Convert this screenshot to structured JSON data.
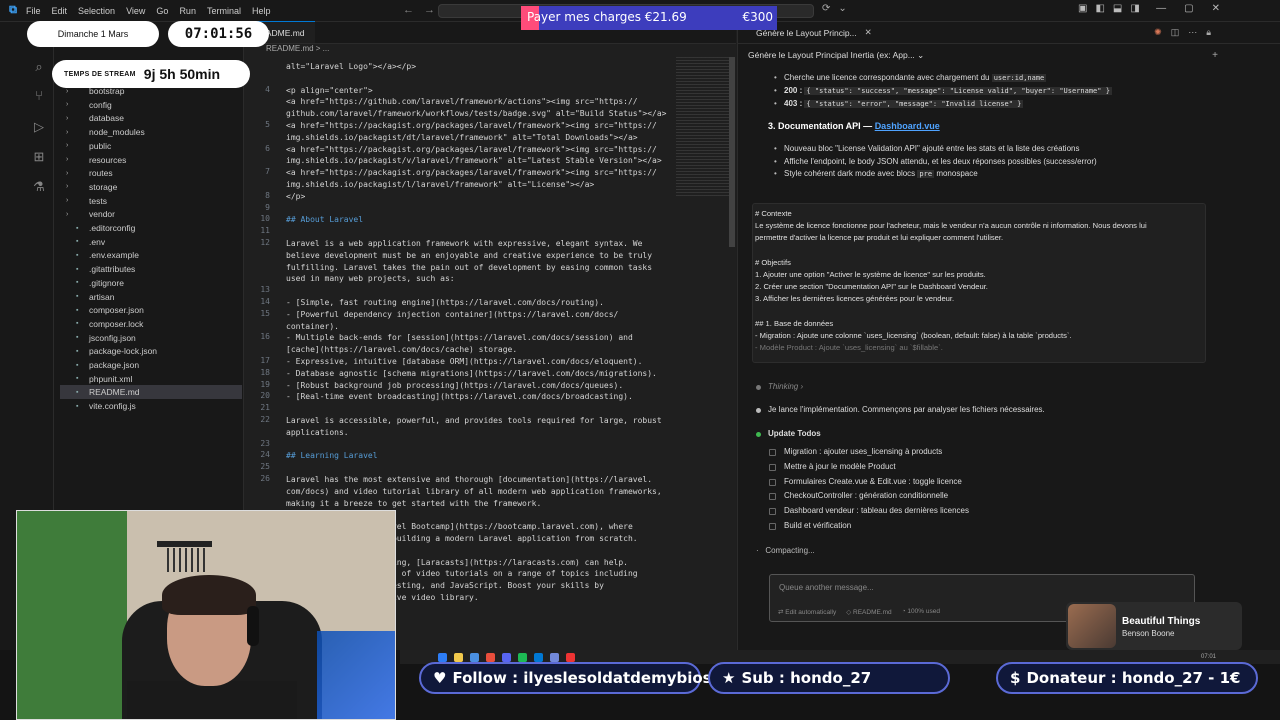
{
  "titlebar": {
    "menu": [
      "File",
      "Edit",
      "Selection",
      "View",
      "Go",
      "Run",
      "Terminal",
      "Help"
    ]
  },
  "sidebar": {
    "items": [
      {
        "label": "bootstrap",
        "kind": "folder",
        "indent": 1
      },
      {
        "label": "config",
        "kind": "folder",
        "indent": 1
      },
      {
        "label": "database",
        "kind": "folder",
        "indent": 1
      },
      {
        "label": "node_modules",
        "kind": "folder",
        "indent": 1
      },
      {
        "label": "public",
        "kind": "folder",
        "indent": 1
      },
      {
        "label": "resources",
        "kind": "folder",
        "indent": 1
      },
      {
        "label": "routes",
        "kind": "folder",
        "indent": 1
      },
      {
        "label": "storage",
        "kind": "folder",
        "indent": 1
      },
      {
        "label": "tests",
        "kind": "folder",
        "indent": 1
      },
      {
        "label": "vendor",
        "kind": "folder",
        "indent": 1
      },
      {
        "label": ".editorconfig",
        "kind": "file",
        "indent": 1
      },
      {
        "label": ".env",
        "kind": "file",
        "indent": 1
      },
      {
        "label": ".env.example",
        "kind": "file",
        "indent": 1
      },
      {
        "label": ".gitattributes",
        "kind": "file",
        "indent": 1
      },
      {
        "label": ".gitignore",
        "kind": "file",
        "indent": 1
      },
      {
        "label": "artisan",
        "kind": "file",
        "indent": 1
      },
      {
        "label": "composer.json",
        "kind": "file",
        "indent": 1
      },
      {
        "label": "composer.lock",
        "kind": "file",
        "indent": 1
      },
      {
        "label": "jsconfig.json",
        "kind": "file",
        "indent": 1
      },
      {
        "label": "package-lock.json",
        "kind": "file",
        "indent": 1
      },
      {
        "label": "package.json",
        "kind": "file",
        "indent": 1
      },
      {
        "label": "phpunit.xml",
        "kind": "file",
        "indent": 1
      },
      {
        "label": "README.md",
        "kind": "file",
        "indent": 1,
        "selected": true
      },
      {
        "label": "vite.config.js",
        "kind": "file",
        "indent": 1
      }
    ]
  },
  "editor": {
    "tab": "README.md",
    "breadcrumb": "README.md > ...",
    "lines": [
      {
        "n": "",
        "text": "alt=\"Laravel Logo\"></a></p>"
      },
      {
        "n": "",
        "text": ""
      },
      {
        "n": "4",
        "text": "<p align=\"center\">"
      },
      {
        "n": "",
        "text": "<a href=\"https://github.com/laravel/framework/actions\"><img src=\"https://"
      },
      {
        "n": "",
        "text": "github.com/laravel/framework/workflows/tests/badge.svg\" alt=\"Build Status\"></a>"
      },
      {
        "n": "5",
        "text": "<a href=\"https://packagist.org/packages/laravel/framework\"><img src=\"https://"
      },
      {
        "n": "",
        "text": "img.shields.io/packagist/dt/laravel/framework\" alt=\"Total Downloads\"></a>"
      },
      {
        "n": "6",
        "text": "<a href=\"https://packagist.org/packages/laravel/framework\"><img src=\"https://"
      },
      {
        "n": "",
        "text": "img.shields.io/packagist/v/laravel/framework\" alt=\"Latest Stable Version\"></a>"
      },
      {
        "n": "7",
        "text": "<a href=\"https://packagist.org/packages/laravel/framework\"><img src=\"https://"
      },
      {
        "n": "",
        "text": "img.shields.io/packagist/l/laravel/framework\" alt=\"License\"></a>"
      },
      {
        "n": "8",
        "text": "</p>"
      },
      {
        "n": "9",
        "text": ""
      },
      {
        "n": "10",
        "text": "## About Laravel"
      },
      {
        "n": "11",
        "text": ""
      },
      {
        "n": "12",
        "text": "Laravel is a web application framework with expressive, elegant syntax. We"
      },
      {
        "n": "",
        "text": "believe development must be an enjoyable and creative experience to be truly"
      },
      {
        "n": "",
        "text": "fulfilling. Laravel takes the pain out of development by easing common tasks"
      },
      {
        "n": "",
        "text": "used in many web projects, such as:"
      },
      {
        "n": "13",
        "text": ""
      },
      {
        "n": "14",
        "text": "- [Simple, fast routing engine](https://laravel.com/docs/routing)."
      },
      {
        "n": "15",
        "text": "- [Powerful dependency injection container](https://laravel.com/docs/"
      },
      {
        "n": "",
        "text": "container)."
      },
      {
        "n": "16",
        "text": "- Multiple back-ends for [session](https://laravel.com/docs/session) and"
      },
      {
        "n": "",
        "text": "[cache](https://laravel.com/docs/cache) storage."
      },
      {
        "n": "17",
        "text": "- Expressive, intuitive [database ORM](https://laravel.com/docs/eloquent)."
      },
      {
        "n": "18",
        "text": "- Database agnostic [schema migrations](https://laravel.com/docs/migrations)."
      },
      {
        "n": "19",
        "text": "- [Robust background job processing](https://laravel.com/docs/queues)."
      },
      {
        "n": "20",
        "text": "- [Real-time event broadcasting](https://laravel.com/docs/broadcasting)."
      },
      {
        "n": "21",
        "text": ""
      },
      {
        "n": "22",
        "text": "Laravel is accessible, powerful, and provides tools required for large, robust"
      },
      {
        "n": "",
        "text": "applications."
      },
      {
        "n": "23",
        "text": ""
      },
      {
        "n": "24",
        "text": "## Learning Laravel"
      },
      {
        "n": "25",
        "text": ""
      },
      {
        "n": "26",
        "text": "Laravel has the most extensive and thorough [documentation](https://laravel."
      },
      {
        "n": "",
        "text": "com/docs) and video tutorial library of all modern web application frameworks,"
      },
      {
        "n": "",
        "text": "making it a breeze to get started with the framework."
      },
      {
        "n": "",
        "text": ""
      },
      {
        "n": "",
        "text": "                   aravel Bootcamp](https://bootcamp.laravel.com), where"
      },
      {
        "n": "",
        "text": "                   gh building a modern Laravel application from scratch."
      },
      {
        "n": "",
        "text": ""
      },
      {
        "n": "",
        "text": "                   eading, [Laracasts](https://laracasts.com) can help."
      },
      {
        "n": "",
        "text": "                   ands of video tutorials on a range of topics including"
      },
      {
        "n": "",
        "text": "                   t testing, and JavaScript. Boost your skills by"
      },
      {
        "n": "",
        "text": "                   ensive video library."
      }
    ]
  },
  "chat": {
    "tab_title": "Génère le Layout Princip...",
    "subtitle": "Génère le Layout Principal Inertia (ex: App...",
    "intro_line": "Cherche une licence correspondante avec chargement du",
    "intro_code": "user:id,name",
    "r200_label": "200 :",
    "r200_code": "{ \"status\": \"success\", \"message\": \"License valid\", \"buyer\": \"Username\" }",
    "r403_label": "403 :",
    "r403_code": "{ \"status\": \"error\", \"message\": \"Invalid license\" }",
    "section3_prefix": "3. Documentation API — ",
    "section3_link": "Dashboard.vue",
    "bullets3": [
      "Nouveau bloc \"License Validation API\" ajouté entre les stats et la liste des créations",
      "Affiche l'endpoint, le body JSON attendu, et les deux réponses possibles (success/error)"
    ],
    "bullet_style_a": "Style cohérent dark mode avec blocs",
    "bullet_style_code": "pre",
    "bullet_style_b": "monospace",
    "context_lines": [
      {
        "text": "# Contexte",
        "dim": false
      },
      {
        "text": "Le système de licence fonctionne pour l'acheteur, mais le vendeur n'a aucun contrôle ni information. Nous devons lui",
        "dim": false
      },
      {
        "text": "permettre d'activer la licence par produit et lui expliquer comment l'utiliser.",
        "dim": false
      },
      {
        "text": "",
        "dim": false
      },
      {
        "text": "# Objectifs",
        "dim": false
      },
      {
        "text": "1. Ajouter une option \"Activer le système de licence\" sur les produits.",
        "dim": false
      },
      {
        "text": "2. Créer une section \"Documentation API\" sur le Dashboard Vendeur.",
        "dim": false
      },
      {
        "text": "3. Afficher les dernières licences générées pour le vendeur.",
        "dim": false
      },
      {
        "text": "",
        "dim": false
      },
      {
        "text": "## 1. Base de données",
        "dim": false
      },
      {
        "text": "- Migration : Ajoute une colonne `uses_licensing` (boolean, default: false) à la table `products`.",
        "dim": false
      },
      {
        "text": "- Modèle Product : Ajoute `uses_licensing` au `$fillable`.",
        "dim": true
      }
    ],
    "thinking": "Thinking",
    "start_msg": "Je lance l'implémentation. Commençons par analyser les fichiers nécessaires.",
    "todos_title": "Update Todos",
    "todos": [
      "Migration : ajouter uses_licensing à products",
      "Mettre à jour le modèle Product",
      "Formulaires Create.vue & Edit.vue : toggle licence",
      "CheckoutController : génération conditionnelle",
      "Dashboard vendeur : tableau des dernières licences",
      "Build et vérification"
    ],
    "compacting": "Compacting...",
    "input_placeholder": "Queue another message...",
    "footer_edit": "Edit automatically",
    "footer_file": "README.md",
    "footer_used": "100% used"
  },
  "overlay": {
    "date": "Dimanche 1 Mars",
    "time": "07:01:56",
    "stream_label": "TEMPS DE STREAM",
    "stream_value": "9j 5h 50min",
    "goal_label": "Payer mes charges €21.69",
    "goal_amount": "€300",
    "goal_progress": 0.07,
    "follow": "Follow : ilyeslesoldatdemybios",
    "sub": "Sub : hondo_27",
    "donor": "Donateur : hondo_27 - 1€",
    "song": "Beautiful Things",
    "artist": "Benson Boone",
    "taskbar_time": "07:01"
  },
  "colors": {
    "accent": "#0078d4",
    "goal_bg": "#3d3dbd",
    "goal_fill": "#ff4c7a",
    "link": "#4fa3ff",
    "todo_done": "#3fb950"
  }
}
